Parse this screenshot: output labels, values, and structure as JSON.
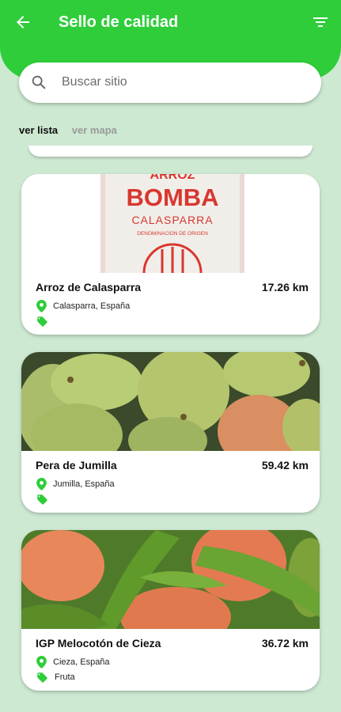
{
  "header": {
    "title": "Sello de calidad",
    "back_icon": "arrow-back-icon",
    "filter_icon": "filter-icon",
    "color": "#2fcd3a"
  },
  "search": {
    "placeholder": "Buscar sitio",
    "icon": "search-icon"
  },
  "tabs": [
    {
      "label": "ver lista",
      "active": true
    },
    {
      "label": "ver mapa",
      "active": false
    }
  ],
  "cards": [
    {
      "name": "Arroz de Calasparra",
      "distance": "17.26 km",
      "location": "Calasparra, España",
      "tag": "",
      "image": "rice-sack-image",
      "image_text": {
        "top": "ARROZ",
        "brand": "BOMBA",
        "place": "CALASPARRA",
        "seal": "DENOMINACION DE ORIGEN"
      }
    },
    {
      "name": "Pera de Jumilla",
      "distance": "59.42 km",
      "location": "Jumilla, España",
      "tag": "",
      "image": "pears-image"
    },
    {
      "name": "IGP Melocotón de Cieza",
      "distance": "36.72 km",
      "location": "Cieza, España",
      "tag": "Fruta",
      "image": "peaches-image"
    }
  ],
  "colors": {
    "accent": "#2fcd3a",
    "background": "#cde9d2",
    "rice_red": "#d8372f"
  }
}
